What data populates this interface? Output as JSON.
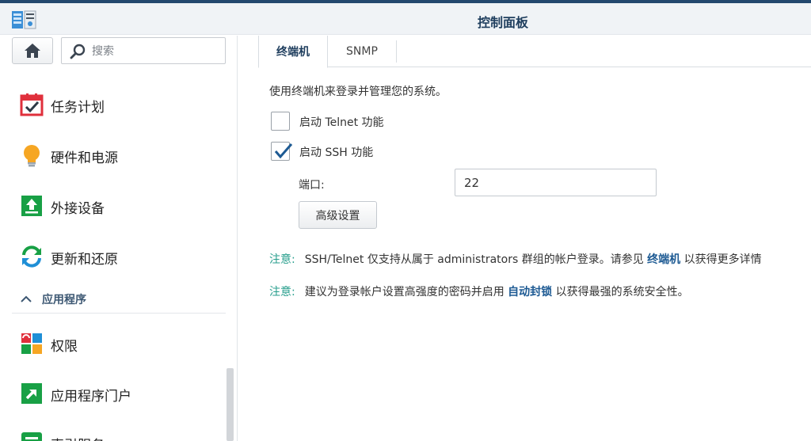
{
  "window": {
    "title": "控制面板"
  },
  "sidebar": {
    "search": {
      "placeholder": "搜索"
    },
    "items": [
      {
        "label": "任务计划",
        "icon": "calendar-check-icon"
      },
      {
        "label": "硬件和电源",
        "icon": "lightbulb-icon"
      },
      {
        "label": "外接设备",
        "icon": "upload-device-icon"
      },
      {
        "label": "更新和还原",
        "icon": "refresh-icon"
      }
    ],
    "section": {
      "label": "应用程序",
      "icon": "chevron-up-icon"
    },
    "app_items": [
      {
        "label": "权限",
        "icon": "privileges-icon"
      },
      {
        "label": "应用程序门户",
        "icon": "app-portal-icon"
      },
      {
        "label": "索引服务",
        "icon": "index-service-icon"
      }
    ]
  },
  "tabs": [
    {
      "label": "终端机",
      "active": true
    },
    {
      "label": "SNMP",
      "active": false
    }
  ],
  "content": {
    "description": "使用终端机来登录并管理您的系统。",
    "telnet": {
      "label": "启动 Telnet 功能",
      "checked": false
    },
    "ssh": {
      "label": "启动 SSH 功能",
      "checked": true
    },
    "port": {
      "label": "端口:",
      "value": "22"
    },
    "advanced_button": "高级设置",
    "note1": {
      "tag": "注意:",
      "text_before": "SSH/Telnet 仅支持从属于 administrators 群组的帐户登录。请参见",
      "link": "终端机",
      "text_after": "以获得更多详情"
    },
    "note2": {
      "tag": "注意:",
      "text_before": "建议为登录帐户设置高强度的密码并启用",
      "link": "自动封锁",
      "text_after": "以获得最强的系统安全性。"
    }
  },
  "colors": {
    "accent": "#1d5a93",
    "note_tag": "#279e8c",
    "title": "#1f3e5e"
  }
}
